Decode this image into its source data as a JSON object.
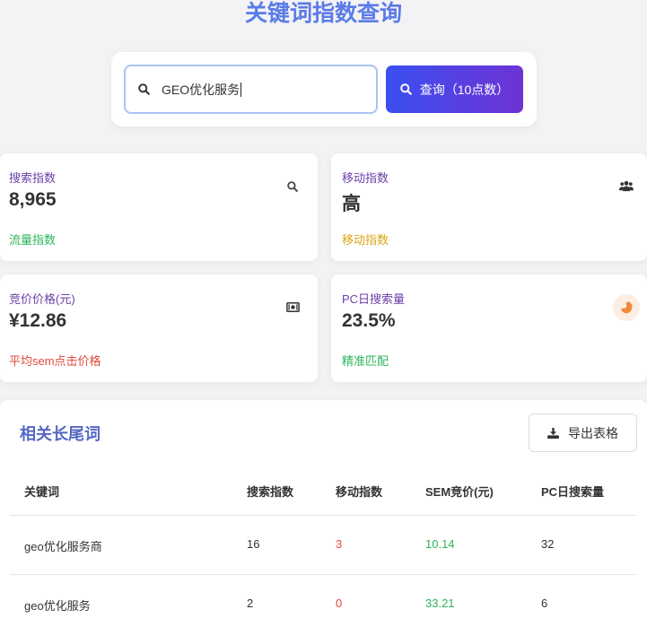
{
  "page": {
    "title": "关键词指数查询"
  },
  "search": {
    "value": "GEO优化服务",
    "button_label": "查询（10点数）"
  },
  "stats": [
    {
      "label": "搜索指数",
      "value": "8,965",
      "sub": "流量指数",
      "sub_color": "#2db45a",
      "icon": "search-icon"
    },
    {
      "label": "移动指数",
      "value": "高",
      "sub": "移动指数",
      "sub_color": "#d9a514",
      "icon": "users-icon"
    },
    {
      "label": "竞价价格(元)",
      "value": "¥12.86",
      "sub": "平均sem点击价格",
      "sub_color": "#e04a3c",
      "icon": "money-icon"
    },
    {
      "label": "PC日搜索量",
      "value": "23.5%",
      "sub": "精准匹配",
      "sub_color": "#2db45a",
      "icon": "pie-chart-icon"
    }
  ],
  "table": {
    "title": "相关长尾词",
    "export_label": "导出表格",
    "headers": [
      "关键词",
      "搜索指数",
      "移动指数",
      "SEM竞价(元)",
      "PC日搜索量"
    ],
    "rows": [
      [
        "geo优化服务商",
        "16",
        "3",
        "10.14",
        "32"
      ],
      [
        "geo优化服务",
        "2",
        "0",
        "33.21",
        "6"
      ]
    ]
  },
  "colors": {
    "accent": "#5b7be8",
    "red": "#e04a3c",
    "green": "#2db45a"
  }
}
